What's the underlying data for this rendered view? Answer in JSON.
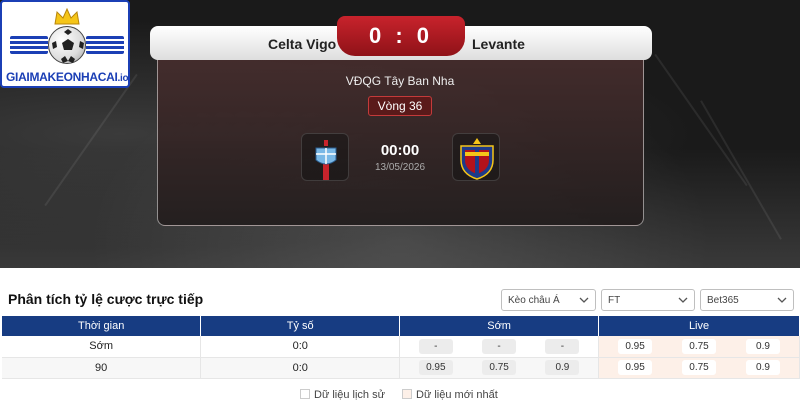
{
  "site": {
    "logo_text_main": "GIAIMAKEONHACAI",
    "logo_text_tld": ".io"
  },
  "match": {
    "home_team": "Celta Vigo",
    "away_team": "Levante",
    "score": "0 : 0",
    "league": "VĐQG Tây Ban Nha",
    "round": "Vòng 36",
    "time": "00:00",
    "date": "13/05/2026"
  },
  "odds_section": {
    "title": "Phân tích tỷ lệ cược trực tiếp",
    "filters": [
      {
        "value": "Kèo châu Á"
      },
      {
        "value": "FT"
      },
      {
        "value": "Bet365"
      }
    ],
    "columns": [
      "Thời gian",
      "Tỷ số",
      "Sớm",
      "Live"
    ],
    "rows": [
      {
        "time": "Sớm",
        "score": "0:0",
        "early": [
          "-",
          "-",
          "-"
        ],
        "live": [
          "0.95",
          "0.75",
          "0.9"
        ]
      },
      {
        "time": "90",
        "score": "0:0",
        "early": [
          "0.95",
          "0.75",
          "0.9"
        ],
        "live": [
          "0.95",
          "0.75",
          "0.9"
        ]
      }
    ],
    "legend": [
      "Dữ liệu lịch sử",
      "Dữ liệu mới nhất"
    ]
  },
  "colors": {
    "header_blue": "#173c82",
    "score_red": "#c8232c",
    "logo_blue": "#1b3fb5",
    "live_highlight": "#fdf0e8"
  },
  "icons": [
    "crown-icon",
    "soccer-ball-icon",
    "celta-vigo-crest-icon",
    "levante-crest-icon",
    "chevron-down-icon"
  ]
}
